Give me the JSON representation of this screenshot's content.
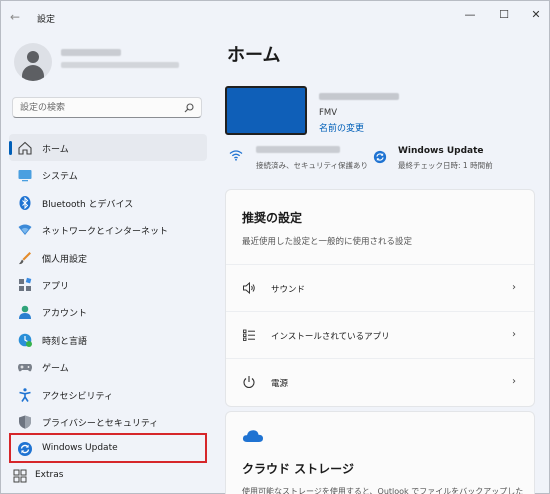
{
  "window": {
    "title": "設定",
    "back_glyph": "←",
    "controls": {
      "minimize": "—",
      "maximize": "☐",
      "close": "✕"
    }
  },
  "profile": {
    "avatar_icon": "user-avatar-icon"
  },
  "search": {
    "placeholder": "設定の検索",
    "icon": "search-icon"
  },
  "sidebar": {
    "items": [
      {
        "label": "ホーム",
        "icon": "home-icon",
        "active": true
      },
      {
        "label": "システム",
        "icon": "system-icon"
      },
      {
        "label": "Bluetooth とデバイス",
        "icon": "bluetooth-icon"
      },
      {
        "label": "ネットワークとインターネット",
        "icon": "network-icon"
      },
      {
        "label": "個人用設定",
        "icon": "personalization-icon"
      },
      {
        "label": "アプリ",
        "icon": "apps-icon"
      },
      {
        "label": "アカウント",
        "icon": "account-icon"
      },
      {
        "label": "時刻と言語",
        "icon": "time-language-icon"
      },
      {
        "label": "ゲーム",
        "icon": "gaming-icon"
      },
      {
        "label": "アクセシビリティ",
        "icon": "accessibility-icon"
      },
      {
        "label": "プライバシーとセキュリティ",
        "icon": "privacy-shield-icon"
      },
      {
        "label": "Windows Update",
        "icon": "windows-update-icon",
        "highlighted": true
      }
    ],
    "extras": {
      "label": "Extras",
      "icon": "extras-icon"
    }
  },
  "main": {
    "title": "ホーム",
    "device": {
      "model": "FMV",
      "rename_link": "名前の変更"
    },
    "status": {
      "network_sub": "接続済み、セキュリティ保護あり",
      "update_title": "Windows Update",
      "update_sub": "最終チェック日時: 1 時間前"
    },
    "recommended": {
      "title": "推奨の設定",
      "subtitle": "最近使用した設定と一般的に使用される設定",
      "rows": [
        {
          "label": "サウンド",
          "icon": "speaker-icon"
        },
        {
          "label": "インストールされているアプリ",
          "icon": "installed-apps-icon"
        },
        {
          "label": "電源",
          "icon": "power-icon"
        }
      ]
    },
    "cloud": {
      "title": "クラウド ストレージ",
      "subtitle": "使用可能なストレージを使用すると、Outlook でファイルをバックアップした",
      "icon": "cloud-icon"
    }
  },
  "colors": {
    "accent": "#005fb8",
    "highlight_border": "#d6262a",
    "device_screen": "#0f5fb8"
  }
}
